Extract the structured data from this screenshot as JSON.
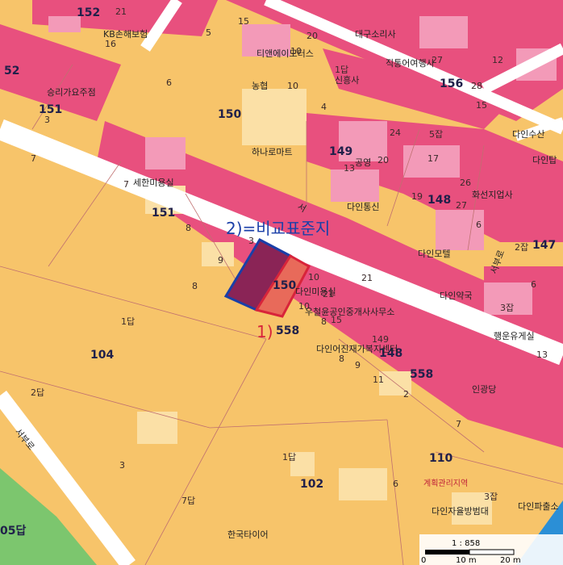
{
  "map": {
    "annotation_1": "1)",
    "annotation_2": "2)=비교표준지",
    "scale_label": "1 : 858",
    "scale_ticks": [
      "0",
      "10 m",
      "20 m"
    ],
    "zone_label": "계획관리지역",
    "block_numbers": [
      "152",
      "150",
      "156",
      "149",
      "148",
      "151",
      "147",
      "104",
      "102",
      "110",
      "558",
      "558",
      "52",
      "151",
      "148",
      "150",
      "05답"
    ],
    "business_labels": [
      "KB손해보험",
      "티앤에이모터스",
      "대구소리사",
      "신흥사",
      "직통어여행사",
      "농협",
      "하나로마트",
      "공영",
      "다인수산",
      "다인탑",
      "세한미용실",
      "다인통신",
      "화선지업사",
      "다인모텔",
      "다인약국",
      "다인미용실",
      "우철윤공인중개사사무소",
      "다인어진재가복지센터",
      "행운유게실",
      "인광당",
      "승리가요주점",
      "다인자율방범대",
      "다인파출소",
      "한국타이어"
    ],
    "lot_labels": [
      "21",
      "16",
      "5",
      "15",
      "20",
      "10",
      "27",
      "12",
      "28",
      "15",
      "6",
      "10",
      "1답",
      "4",
      "24",
      "5잡",
      "17",
      "13",
      "20",
      "26",
      "19",
      "27",
      "6",
      "7",
      "8",
      "9",
      "3",
      "2잡",
      "10",
      "6",
      "8",
      "21",
      "3잡",
      "13",
      "1답",
      "2답",
      "3",
      "7답",
      "1답",
      "2",
      "7",
      "6",
      "3잡",
      "8",
      "11",
      "9",
      "149",
      "10",
      "15",
      "8",
      "7",
      "21",
      "3"
    ],
    "road_labels": [
      "서",
      "서부로",
      "서부로"
    ]
  },
  "colors": {
    "commercial": "#e8507e",
    "commercial_light": "#f39ab8",
    "residential": "#f7c46a",
    "residential_light": "#fbe0a6",
    "road": "#ffffff",
    "green": "#7cc66e",
    "water": "#2b8fd6",
    "blue_outline": "#1a3fa8",
    "red_outline": "#d8243a"
  }
}
